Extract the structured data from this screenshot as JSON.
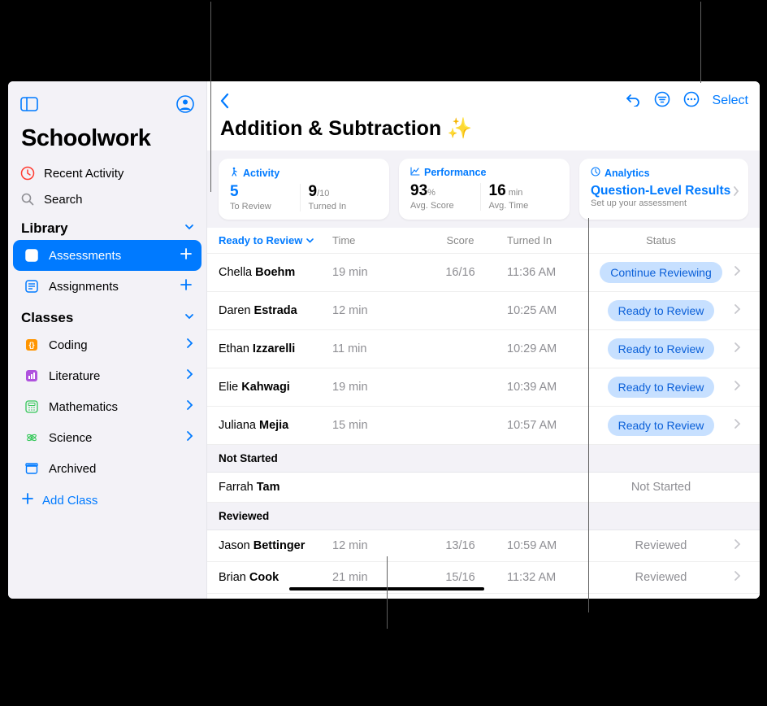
{
  "sidebar": {
    "app_title": "Schoolwork",
    "recent_activity": "Recent Activity",
    "search": "Search",
    "library_header": "Library",
    "assessments": "Assessments",
    "assignments": "Assignments",
    "classes_header": "Classes",
    "classes": [
      {
        "label": "Coding",
        "color": "#ff9500"
      },
      {
        "label": "Literature",
        "color": "#af52de"
      },
      {
        "label": "Mathematics",
        "color": "#34c759"
      },
      {
        "label": "Science",
        "color": "#34c759"
      }
    ],
    "archived": "Archived",
    "add_class": "Add Class"
  },
  "toolbar": {
    "select": "Select"
  },
  "page": {
    "title": "Addition & Subtraction",
    "sparkle": "✨"
  },
  "cards": {
    "activity": {
      "header": "Activity",
      "to_review_val": "5",
      "to_review_lbl": "To Review",
      "turned_in_val": "9",
      "turned_in_total": "/10",
      "turned_in_lbl": "Turned In"
    },
    "performance": {
      "header": "Performance",
      "score_val": "93",
      "score_unit": "%",
      "score_lbl": "Avg. Score",
      "time_val": "16",
      "time_unit": " min",
      "time_lbl": "Avg. Time"
    },
    "analytics": {
      "header": "Analytics",
      "title": "Question-Level Results",
      "sub": "Set up your assessment"
    }
  },
  "table": {
    "headers": {
      "ready": "Ready to Review",
      "time": "Time",
      "score": "Score",
      "turned": "Turned In",
      "status": "Status"
    },
    "groups": [
      {
        "name": null,
        "rows": [
          {
            "first": "Chella",
            "last": "Boehm",
            "time": "19 min",
            "score": "16/16",
            "turned": "11:36 AM",
            "status": "Continue Reviewing",
            "pill": true
          },
          {
            "first": "Daren",
            "last": "Estrada",
            "time": "12 min",
            "score": "",
            "turned": "10:25 AM",
            "status": "Ready to Review",
            "pill": true
          },
          {
            "first": "Ethan",
            "last": "Izzarelli",
            "time": "11 min",
            "score": "",
            "turned": "10:29 AM",
            "status": "Ready to Review",
            "pill": true
          },
          {
            "first": "Elie",
            "last": "Kahwagi",
            "time": "19 min",
            "score": "",
            "turned": "10:39 AM",
            "status": "Ready to Review",
            "pill": true
          },
          {
            "first": "Juliana",
            "last": "Mejia",
            "time": "15 min",
            "score": "",
            "turned": "10:57 AM",
            "status": "Ready to Review",
            "pill": true
          }
        ]
      },
      {
        "name": "Not Started",
        "rows": [
          {
            "first": "Farrah",
            "last": "Tam",
            "time": "",
            "score": "",
            "turned": "",
            "status": "Not Started",
            "pill": false
          }
        ]
      },
      {
        "name": "Reviewed",
        "rows": [
          {
            "first": "Jason",
            "last": "Bettinger",
            "time": "12 min",
            "score": "13/16",
            "turned": "10:59 AM",
            "status": "Reviewed",
            "pill": false
          },
          {
            "first": "Brian",
            "last": "Cook",
            "time": "21 min",
            "score": "15/16",
            "turned": "11:32 AM",
            "status": "Reviewed",
            "pill": false
          }
        ]
      }
    ]
  }
}
